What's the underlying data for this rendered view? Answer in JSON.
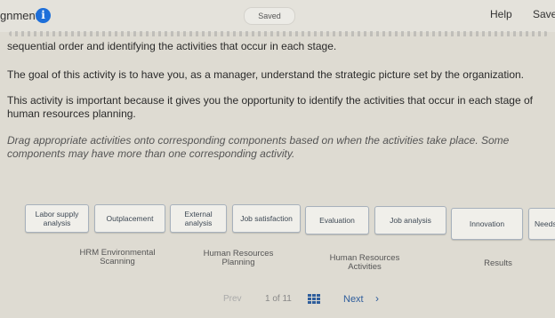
{
  "header": {
    "title": "gnment",
    "info_icon": "i",
    "saved_status": "Saved",
    "help_label": "Help",
    "save_label": "Save"
  },
  "instructions": {
    "line1": "sequential order and identifying the activities that occur in each stage.",
    "line2": "The goal of this activity is to have you, as a manager, understand the strategic picture set by the organization.",
    "line3": "This activity is important because it gives you the opportunity to identify the activities that occur in each stage of human resources planning.",
    "line4": "Drag appropriate activities onto corresponding components based on when the activities take place. Some components may have more than one corresponding activity."
  },
  "activity_bank": [
    "Labor supply analysis",
    "Outplacement",
    "External analysis",
    "Job satisfaction",
    "Evaluation",
    "Job analysis",
    "Innovation",
    "Needs assessment"
  ],
  "targets": [
    "HRM Environmental Scanning",
    "Human Resources Planning",
    "Human Resources Activities",
    "Results"
  ],
  "pagination": {
    "prev_label": "Prev",
    "page_info": "1 of 11",
    "next_label": "Next",
    "next_chevron": "›"
  },
  "colors": {
    "accent": "#1e6fd9",
    "link": "#2f5e9c",
    "background": "#dedbd2"
  }
}
